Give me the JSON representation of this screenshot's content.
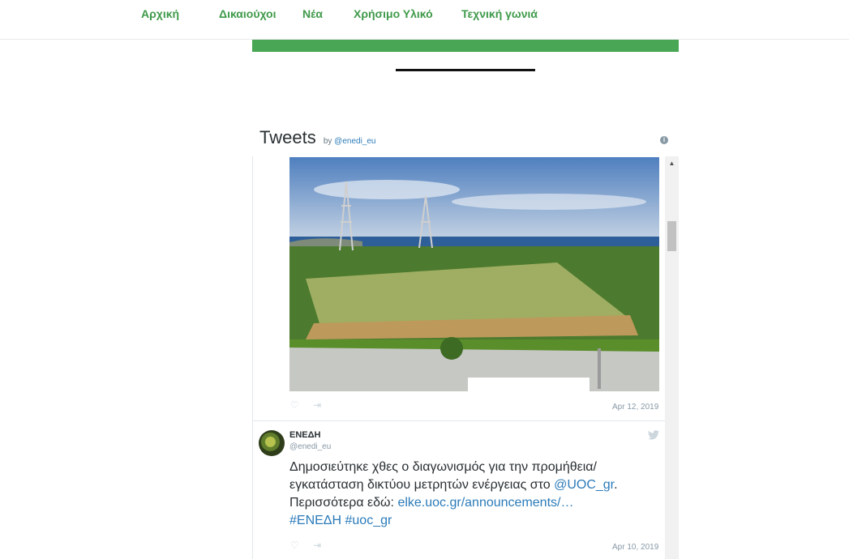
{
  "nav": {
    "items": [
      {
        "label": "Αρχική"
      },
      {
        "label": "Δικαιούχοι"
      },
      {
        "label": "Νέα"
      },
      {
        "label": "Χρήσιμο Υλικό"
      },
      {
        "label": "Τεχνική γωνιά"
      }
    ]
  },
  "colors": {
    "accent": "#48a655",
    "nav_text": "#3f9a4a",
    "link": "#2b7bb9"
  },
  "widget": {
    "title": "Tweets",
    "by_prefix": "by",
    "by_handle": "@enedi_eu",
    "info_icon": "info-icon"
  },
  "tweets": [
    {
      "has_photo": true,
      "date": "Apr 12, 2019",
      "actions": [
        "heart-icon",
        "share-icon"
      ]
    },
    {
      "author": "ΕΝΕΔΗ",
      "handle": "@enedi_eu",
      "text_1": "Δημοσιεύτηκε χθες ο διαγωνισμός για την προμήθεια/ εγκατάσταση δικτύου μετρητών ενέργειας στο ",
      "mention": "@UOC_gr",
      "text_2": ". Περισσότερα εδώ: ",
      "url": "elke.uoc.gr/announcements/…",
      "hashtag_1": "#ΕΝΕΔΗ",
      "hashtag_2": "#uoc_gr",
      "date": "Apr 10, 2019",
      "actions": [
        "heart-icon",
        "share-icon"
      ],
      "source_icon": "twitter-bird-icon"
    }
  ]
}
